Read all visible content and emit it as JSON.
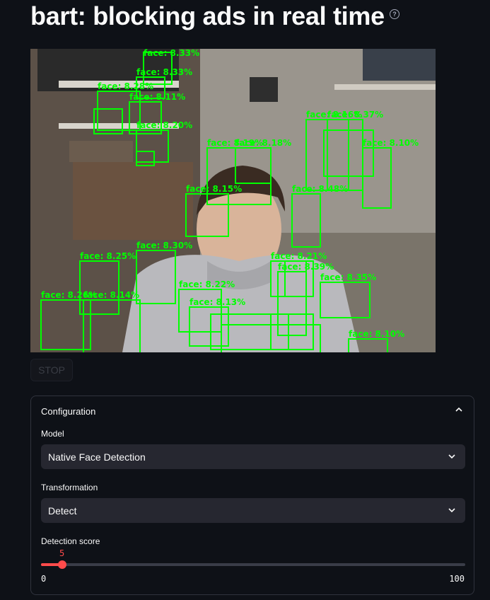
{
  "page": {
    "title": "bart: blocking ads in real time",
    "help_icon": "question-circle-icon"
  },
  "video": {
    "description_icon": "webcam-feed",
    "detections": [
      "face: 8.33%",
      "face: 8.33%",
      "face: 8.28%",
      "face: 8.11%",
      "face: 8.20%",
      "face: 8.19%",
      "face: 8.18%",
      "face: 8.48%",
      "face: 8.16%",
      "face: 8.37%",
      "face: 8.10%",
      "face: 8.15%",
      "face: 8.30%",
      "face: 8.25%",
      "face: 8.26%",
      "face: 8.14%",
      "face: 8.22%",
      "face: 8.21%",
      "face: 8.39%",
      "face: 8.35%",
      "face: 8.10%",
      "face: 8.13%"
    ]
  },
  "controls": {
    "stop_label": "STOP"
  },
  "config": {
    "header": "Configuration",
    "model_label": "Model",
    "model_value": "Native Face Detection",
    "transformation_label": "Transformation",
    "transformation_value": "Detect",
    "score_label": "Detection score",
    "score_value": "5",
    "score_fraction": 0.05,
    "score_min": "0",
    "score_max": "100"
  },
  "colors": {
    "accent": "#ff4b4b",
    "detection_box": "#00ff00",
    "background": "#0e1117"
  }
}
